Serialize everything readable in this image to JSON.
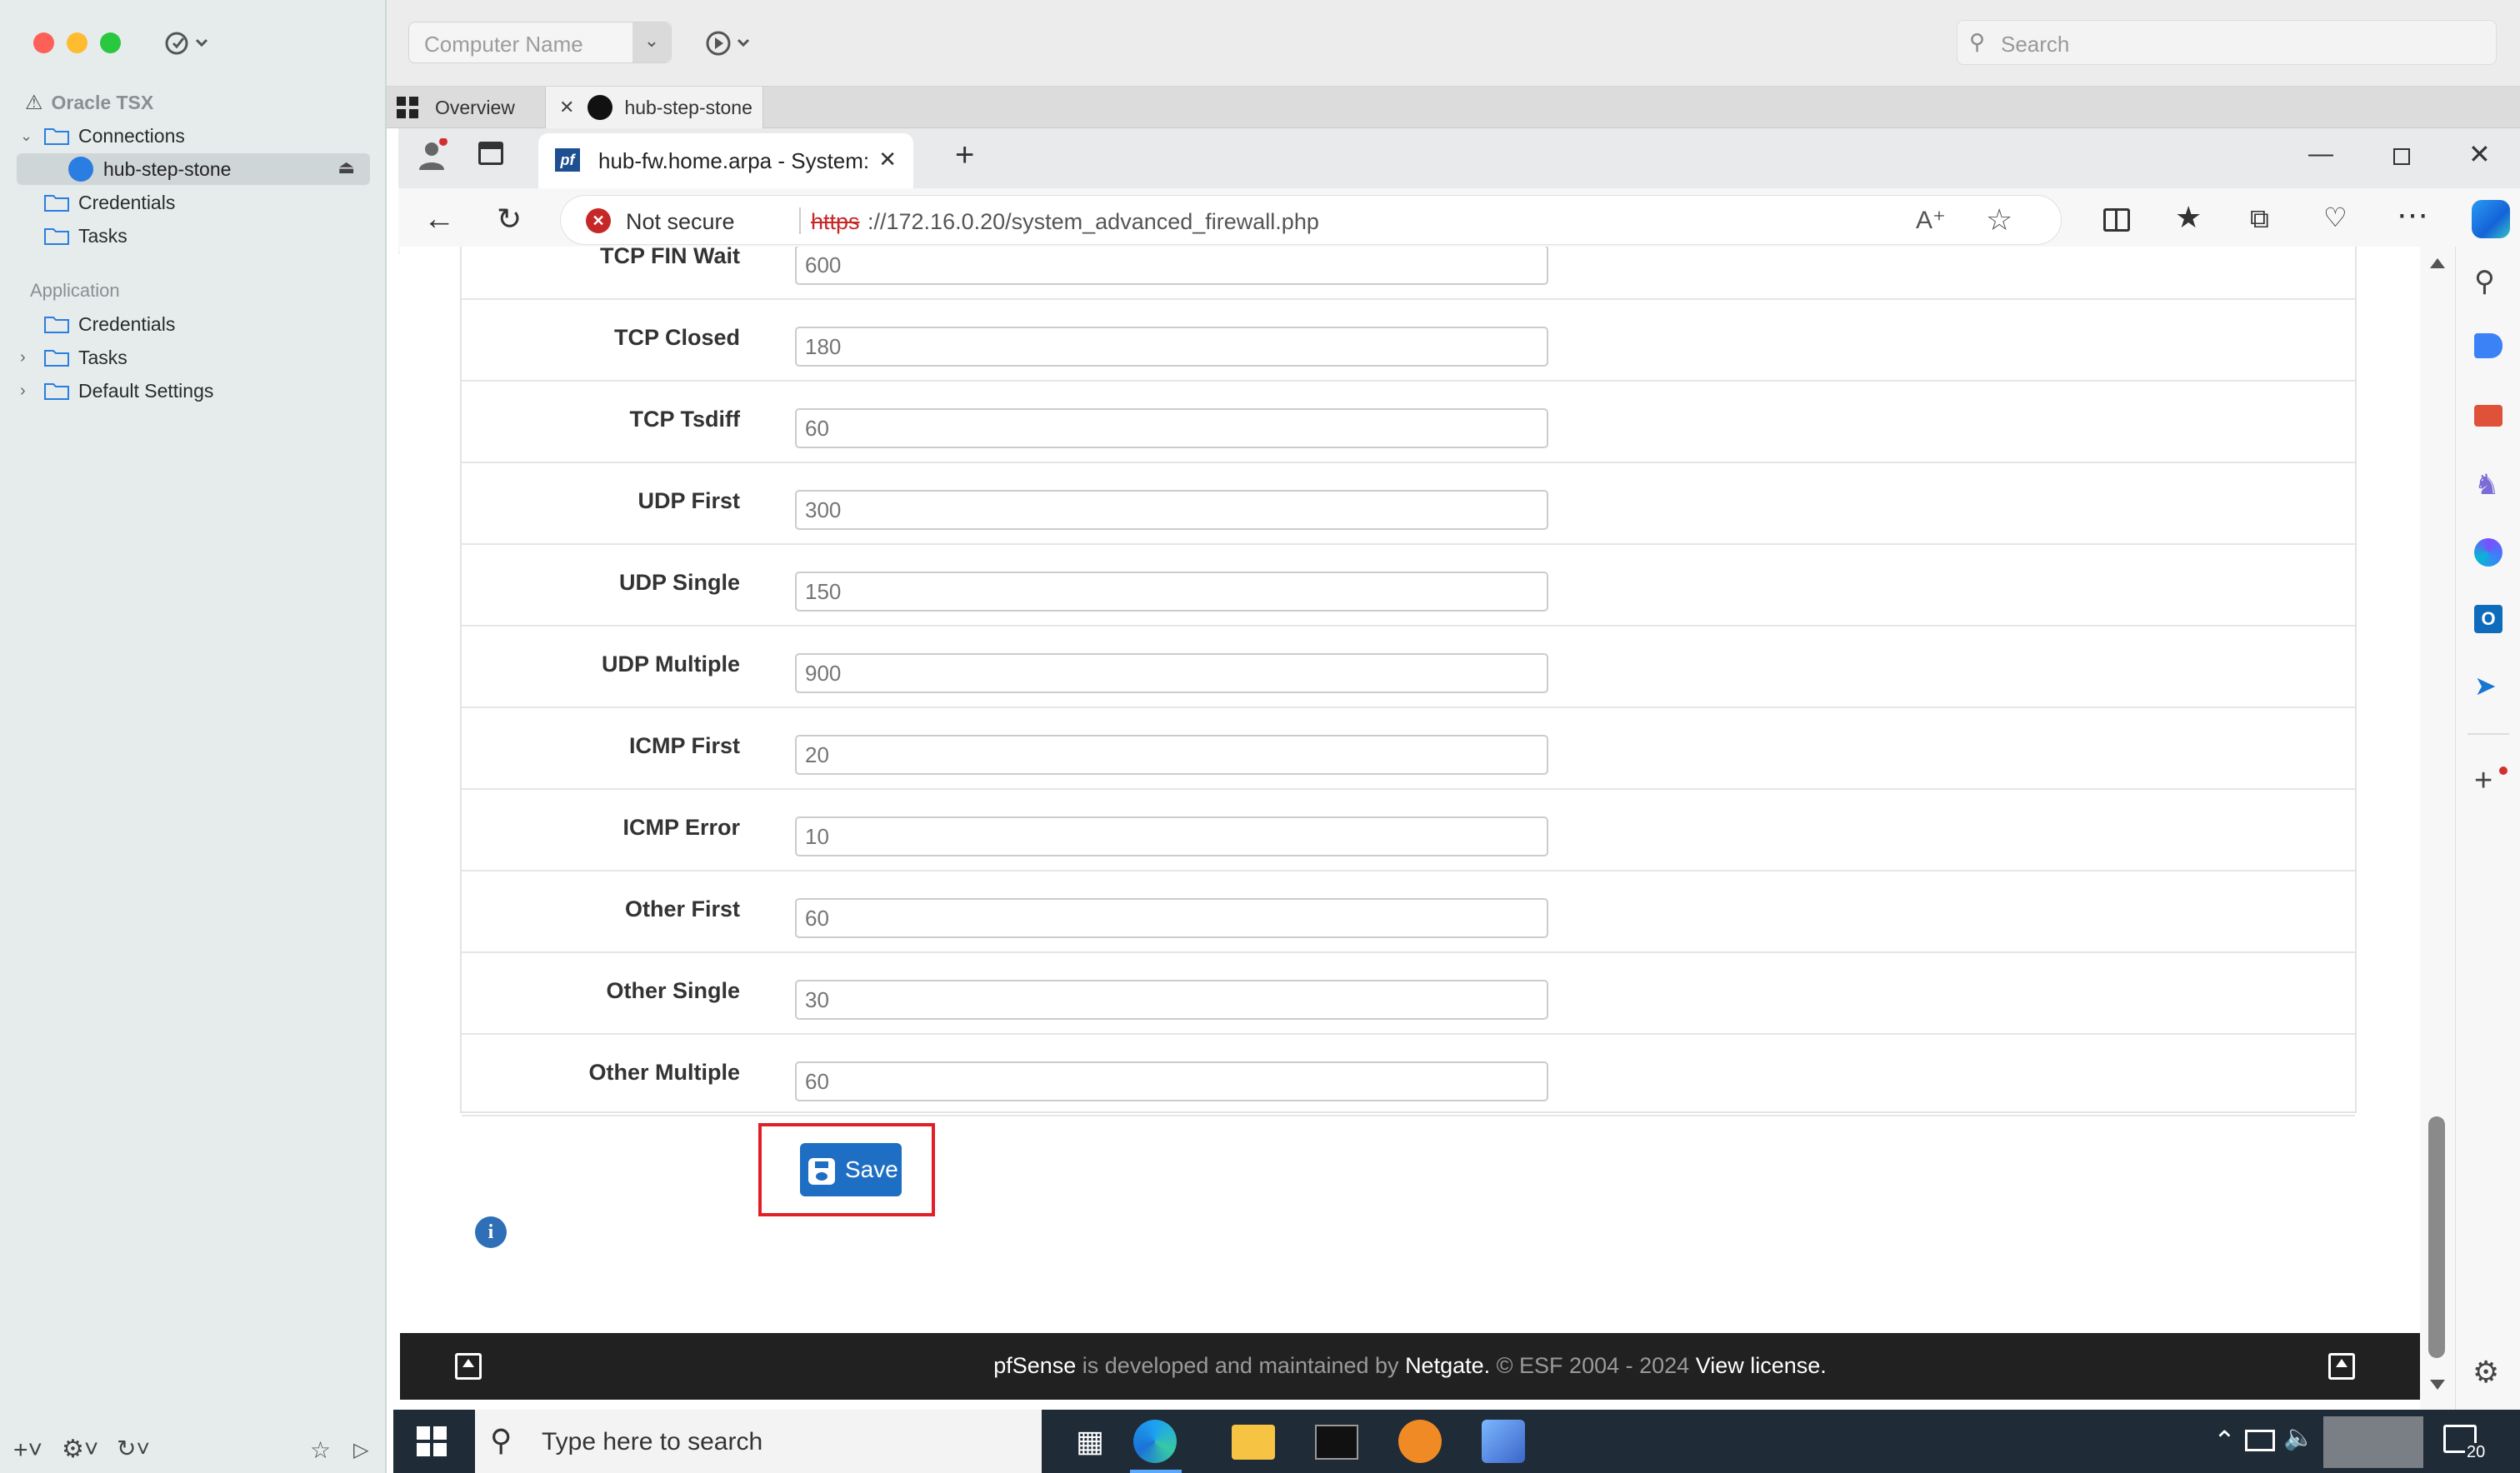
{
  "mac_sidebar": {
    "root_name": "Oracle TSX",
    "connections_label": "Connections",
    "active_connection": "hub-step-stone",
    "credentials_label": "Credentials",
    "tasks_label": "Tasks",
    "application_group": "Application",
    "app_credentials_label": "Credentials",
    "app_tasks_label": "Tasks",
    "default_settings_label": "Default Settings"
  },
  "mac_toolbar": {
    "computer_name_placeholder": "Computer Name",
    "search_placeholder": "Search"
  },
  "mac_tabs": {
    "overview": "Overview",
    "session": "hub-step-stone"
  },
  "browser": {
    "tab_title": "hub-fw.home.arpa - System: Adv",
    "security_label": "Not secure",
    "url_scheme": "https",
    "url_rest": "://172.16.0.20/system_advanced_firewall.php"
  },
  "form": {
    "rows": [
      {
        "label": "TCP FIN Wait",
        "placeholder": "600"
      },
      {
        "label": "TCP Closed",
        "placeholder": "180"
      },
      {
        "label": "TCP Tsdiff",
        "placeholder": "60"
      },
      {
        "label": "UDP First",
        "placeholder": "300"
      },
      {
        "label": "UDP Single",
        "placeholder": "150"
      },
      {
        "label": "UDP Multiple",
        "placeholder": "900"
      },
      {
        "label": "ICMP First",
        "placeholder": "20"
      },
      {
        "label": "ICMP Error",
        "placeholder": "10"
      },
      {
        "label": "Other First",
        "placeholder": "60"
      },
      {
        "label": "Other Single",
        "placeholder": "30"
      },
      {
        "label": "Other Multiple",
        "placeholder": "60"
      }
    ],
    "save_label": "Save"
  },
  "footer": {
    "brand": "pfSense",
    "text1": " is developed and maintained by ",
    "company": "Netgate.",
    "text2": " © ESF 2004 - 2024 ",
    "license": "View license."
  },
  "taskbar": {
    "search_placeholder": "Type here to search",
    "notification_count": "20"
  },
  "colors": {
    "save_button": "#1e6fc3",
    "highlight_border": "#e01f26",
    "footer_bg": "#212121",
    "taskbar_bg": "#1f2b36"
  }
}
